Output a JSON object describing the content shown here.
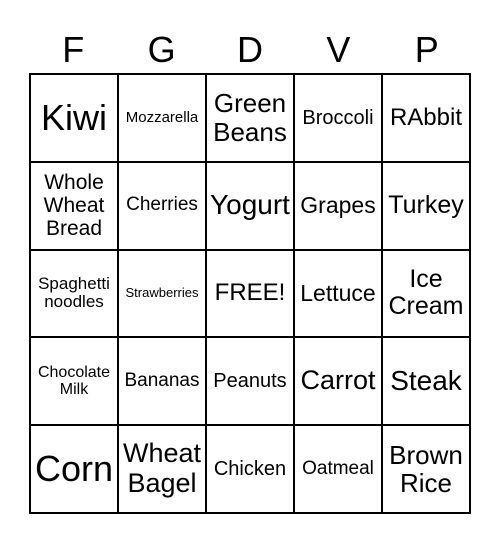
{
  "header": [
    "F",
    "G",
    "D",
    "V",
    "P"
  ],
  "cells": [
    {
      "text": "Kiwi",
      "size": 36
    },
    {
      "text": "Mozzarella",
      "size": 15
    },
    {
      "text": "Green Beans",
      "size": 26
    },
    {
      "text": "Broccoli",
      "size": 20
    },
    {
      "text": "RAbbit",
      "size": 24
    },
    {
      "text": "Whole Wheat Bread",
      "size": 21
    },
    {
      "text": "Cherries",
      "size": 19
    },
    {
      "text": "Yogurt",
      "size": 28
    },
    {
      "text": "Grapes",
      "size": 23
    },
    {
      "text": "Turkey",
      "size": 25
    },
    {
      "text": "Spaghetti noodles",
      "size": 17
    },
    {
      "text": "Strawberries",
      "size": 13
    },
    {
      "text": "FREE!",
      "size": 24
    },
    {
      "text": "Lettuce",
      "size": 23
    },
    {
      "text": "Ice Cream",
      "size": 25
    },
    {
      "text": "Chocolate Milk",
      "size": 16
    },
    {
      "text": "Bananas",
      "size": 19
    },
    {
      "text": "Peanuts",
      "size": 20
    },
    {
      "text": "Carrot",
      "size": 27
    },
    {
      "text": "Steak",
      "size": 28
    },
    {
      "text": "Corn",
      "size": 36
    },
    {
      "text": "Wheat Bagel",
      "size": 27
    },
    {
      "text": "Chicken",
      "size": 20
    },
    {
      "text": "Oatmeal",
      "size": 19
    },
    {
      "text": "Brown Rice",
      "size": 26
    }
  ]
}
